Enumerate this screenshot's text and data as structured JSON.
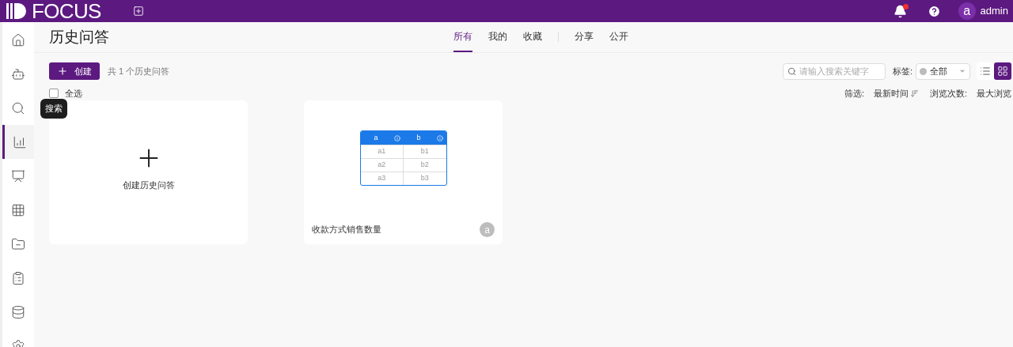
{
  "header": {
    "logo_text": "FOCUS",
    "notification_dot": true,
    "user": {
      "avatar_letter": "a",
      "name": "admin"
    }
  },
  "sidebar": {
    "items": [
      {
        "selected": false
      },
      {
        "selected": false
      },
      {
        "selected": false,
        "tooltip": "搜索"
      },
      {
        "selected": true
      },
      {
        "selected": false
      },
      {
        "selected": false
      },
      {
        "selected": false
      },
      {
        "selected": false
      },
      {
        "selected": false
      },
      {
        "selected": false
      }
    ]
  },
  "page_title": "历史问答",
  "tabs": [
    {
      "label": "所有",
      "selected": true
    },
    {
      "label": "我的",
      "selected": false
    },
    {
      "label": "收藏",
      "selected": false
    },
    {
      "label": "分享",
      "selected": false
    },
    {
      "label": "公开",
      "selected": false
    }
  ],
  "toolbar": {
    "create_button": "创建",
    "count_text": "共 1 个历史问答",
    "search": {
      "placeholder": "请输入搜索关键字"
    },
    "tag_label": "标签:",
    "tag_select": "全部",
    "view_modes": [
      {
        "selected": false
      },
      {
        "selected": true
      }
    ]
  },
  "select_all": {
    "label": "全选",
    "checked": false
  },
  "sort": {
    "filter_label": "筛选:",
    "filter_value": "最新时间",
    "views_label": "浏览次数:",
    "views_value": "最大浏览"
  },
  "cards": [
    {
      "kind": "create",
      "label": "创建历史问答"
    },
    {
      "kind": "item",
      "title": "收款方式销售数量",
      "owner": "a",
      "thumbnail": {
        "columns": [
          "a",
          "b"
        ],
        "rows": [
          [
            "a1",
            "b1"
          ],
          [
            "a2",
            "b2"
          ],
          [
            "a3",
            "b3"
          ]
        ]
      }
    }
  ]
}
